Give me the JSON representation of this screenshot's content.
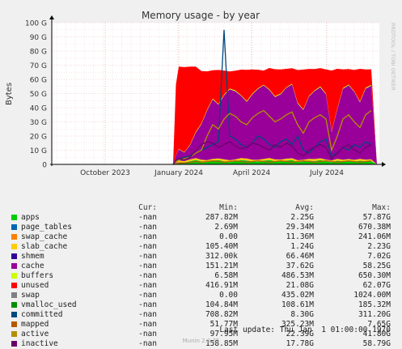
{
  "watermark": "RRDTOOL / TOBI OETIKER",
  "chart_data": {
    "type": "area",
    "title": "Memory usage - by year",
    "ylabel": "Bytes",
    "ylim": [
      0,
      100
    ],
    "y_ticks": [
      "0",
      "10 G",
      "20 G",
      "30 G",
      "40 G",
      "50 G",
      "60 G",
      "70 G",
      "80 G",
      "90 G",
      "100 G"
    ],
    "x_ticks": [
      "October 2023",
      "January 2024",
      "April 2024",
      "July 2024"
    ],
    "grid": true,
    "x": [
      0,
      0.5,
      1,
      2,
      3,
      4,
      5,
      6,
      7,
      8,
      9,
      10,
      11,
      12,
      13,
      14,
      15,
      16,
      17,
      18,
      19,
      20,
      21,
      22,
      23,
      24,
      25,
      26,
      27,
      28,
      29,
      30,
      31,
      32,
      33,
      34,
      35,
      36
    ],
    "x_unit": "weeks since first data (January 2024)",
    "series": [
      {
        "name": "apps",
        "color": "#00cc00",
        "values": [
          0,
          0.5,
          1.5,
          1.2,
          2.2,
          3,
          2,
          1.5,
          2.5,
          3,
          2,
          1.5,
          2.2,
          3,
          2.5,
          2,
          1.8,
          2.5,
          3,
          2.2,
          2,
          2.5,
          3,
          1.5,
          2,
          2.5,
          2.2,
          3,
          2,
          1.5,
          2.5,
          2,
          2.2,
          1.8,
          2.5,
          2,
          2.2
        ]
      },
      {
        "name": "page_tables",
        "color": "#0066b3",
        "values": [
          0,
          0.1,
          0.1,
          0.1,
          0.1,
          0.1,
          0.1,
          0.2,
          0.1,
          0.1,
          0.2,
          0.1,
          0.1,
          0.1,
          0.2,
          0.1,
          0.1,
          0.1,
          0.1,
          0.1,
          0.1,
          0.1,
          0.1,
          0.1,
          0.1,
          0.1,
          0.1,
          0.1,
          0.1,
          0.1,
          0.1,
          0.1,
          0.1,
          0.1,
          0.1,
          0.1,
          0.1
        ]
      },
      {
        "name": "swap_cache",
        "color": "#ff8000",
        "values": [
          0,
          0,
          0,
          0,
          0,
          0,
          0,
          0,
          0,
          0,
          0,
          0,
          0,
          0,
          0,
          0,
          0,
          0,
          0,
          0,
          0,
          0,
          0,
          0,
          0,
          0,
          0,
          0,
          0,
          0,
          0,
          0,
          0,
          0,
          0,
          0,
          0
        ]
      },
      {
        "name": "slab_cache",
        "color": "#ffcc00",
        "values": [
          0,
          0.5,
          1,
          1,
          1.2,
          1.3,
          1.2,
          1.3,
          1.2,
          1.1,
          1.4,
          1.3,
          1.2,
          1.3,
          1.4,
          1.2,
          1.3,
          1.2,
          1.3,
          1.2,
          1.3,
          1.4,
          1.2,
          1.3,
          1.2,
          1.3,
          1.4,
          1.2,
          1.3,
          1.2,
          1.3,
          1.2,
          1.4,
          1.3,
          1.2,
          1.3,
          1.2
        ]
      },
      {
        "name": "shmem",
        "color": "#330099",
        "values": [
          0,
          0,
          0.1,
          0.05,
          0.1,
          0.05,
          0.1,
          0.05,
          0.1,
          0.05,
          0.1,
          0.05,
          0.1,
          0.05,
          0.1,
          0.05,
          0.1,
          0.05,
          0.1,
          0.05,
          0.1,
          0.05,
          0.1,
          0.05,
          0.1,
          0.05,
          0.1,
          0.05,
          0.1,
          0.05,
          0.1,
          0.05,
          0.1,
          0.05,
          0.1,
          0.05,
          0.1
        ]
      },
      {
        "name": "cache",
        "color": "#990099",
        "values": [
          0,
          5,
          8,
          6,
          10,
          18,
          25,
          35,
          42,
          38,
          45,
          50,
          48,
          44,
          40,
          46,
          50,
          52,
          48,
          44,
          46,
          50,
          52,
          40,
          35,
          44,
          48,
          50,
          46,
          20,
          35,
          50,
          52,
          48,
          40,
          50,
          52
        ]
      },
      {
        "name": "buffers",
        "color": "#ccff00",
        "values": [
          0,
          0.2,
          0.3,
          0.3,
          0.4,
          0.5,
          0.5,
          0.6,
          0.5,
          0.4,
          0.5,
          0.6,
          0.5,
          0.4,
          0.5,
          0.6,
          0.5,
          0.4,
          0.5,
          0.6,
          0.5,
          0.4,
          0.5,
          0.6,
          0.5,
          0.4,
          0.5,
          0.6,
          0.5,
          0.4,
          0.5,
          0.6,
          0.5,
          0.4,
          0.5,
          0.6,
          0.5
        ]
      },
      {
        "name": "unused",
        "color": "#ff0000",
        "values": [
          0,
          50,
          58,
          60,
          55,
          46,
          37,
          27,
          20,
          24,
          17,
          12,
          14,
          18,
          22,
          17,
          13,
          10,
          15,
          19,
          17,
          13,
          11,
          23,
          28,
          19,
          15,
          13,
          17,
          43,
          28,
          13,
          11,
          15,
          23,
          13,
          11
        ]
      },
      {
        "name": "swap",
        "color": "#808080",
        "values": [
          0,
          0,
          0,
          0,
          0,
          0,
          0,
          0,
          0,
          0,
          0,
          0,
          0,
          0,
          0,
          0,
          0,
          0,
          0,
          0,
          0,
          0,
          0,
          0,
          0,
          0,
          0,
          0,
          0,
          0,
          0,
          0,
          0,
          0,
          0,
          0,
          0
        ]
      }
    ],
    "line_series": [
      {
        "name": "vmalloc_used",
        "color": "#008f00",
        "values": [
          0,
          0.1,
          0.1,
          0.1,
          0.1,
          0.1,
          0.1,
          0.1,
          0.1,
          0.1,
          0.1,
          0.1,
          0.1,
          0.1,
          0.1,
          0.1,
          0.1,
          0.1,
          0.1,
          0.1,
          0.1,
          0.1,
          0.1,
          0.1,
          0.1,
          0.1,
          0.1,
          0.1,
          0.1,
          0.1,
          0.1,
          0.1,
          0.1,
          0.1,
          0.1,
          0.1,
          0.1
        ]
      },
      {
        "name": "committed",
        "color": "#00487d",
        "values": [
          0,
          2,
          4,
          5,
          6,
          8,
          10,
          12,
          14,
          16,
          95,
          20,
          18,
          14,
          12,
          15,
          20,
          18,
          14,
          12,
          16,
          18,
          14,
          20,
          10,
          8,
          12,
          16,
          18,
          6,
          8,
          12,
          10,
          14,
          12,
          16,
          14
        ]
      },
      {
        "name": "mapped",
        "color": "#b35a00",
        "values": [
          0,
          0.5,
          1,
          1,
          1.5,
          2,
          1.5,
          2,
          2.5,
          2,
          1.5,
          2,
          2.5,
          2,
          1.5,
          2,
          2.5,
          2,
          1.5,
          2,
          2.5,
          2,
          1.5,
          2,
          2.5,
          2,
          1.5,
          2,
          2.5,
          2,
          1.5,
          2,
          2.5,
          2,
          1.5,
          2,
          2.5
        ]
      },
      {
        "name": "active",
        "color": "#b38f00",
        "values": [
          0,
          2,
          3,
          4,
          5,
          8,
          10,
          20,
          28,
          25,
          32,
          36,
          34,
          30,
          28,
          33,
          36,
          38,
          34,
          30,
          32,
          35,
          37,
          28,
          22,
          30,
          33,
          35,
          32,
          10,
          20,
          32,
          35,
          30,
          26,
          35,
          38
        ]
      },
      {
        "name": "inactive",
        "color": "#6b006b",
        "values": [
          0,
          3,
          4,
          3,
          5,
          10,
          14,
          16,
          15,
          12,
          14,
          16,
          13,
          11,
          12,
          15,
          14,
          12,
          10,
          14,
          12,
          15,
          13,
          8,
          6,
          10,
          12,
          14,
          12,
          4,
          8,
          12,
          14,
          10,
          8,
          12,
          14
        ]
      }
    ]
  },
  "legend": {
    "headers": {
      "cur": "Cur:",
      "min": "Min:",
      "avg": "Avg:",
      "max": "Max:"
    },
    "rows": [
      {
        "name": "apps",
        "color": "#00cc00",
        "cur": "-nan",
        "min": "287.82M",
        "avg": "2.25G",
        "max": "57.87G"
      },
      {
        "name": "page_tables",
        "color": "#0066b3",
        "cur": "-nan",
        "min": "2.69M",
        "avg": "29.34M",
        "max": "670.38M"
      },
      {
        "name": "swap_cache",
        "color": "#ff8000",
        "cur": "-nan",
        "min": "0.00",
        "avg": "11.36M",
        "max": "241.06M"
      },
      {
        "name": "slab_cache",
        "color": "#ffcc00",
        "cur": "-nan",
        "min": "105.40M",
        "avg": "1.24G",
        "max": "2.23G"
      },
      {
        "name": "shmem",
        "color": "#330099",
        "cur": "-nan",
        "min": "312.00k",
        "avg": "66.46M",
        "max": "7.02G"
      },
      {
        "name": "cache",
        "color": "#990099",
        "cur": "-nan",
        "min": "151.21M",
        "avg": "37.62G",
        "max": "58.25G"
      },
      {
        "name": "buffers",
        "color": "#ccff00",
        "cur": "-nan",
        "min": "6.58M",
        "avg": "486.53M",
        "max": "650.30M"
      },
      {
        "name": "unused",
        "color": "#ff0000",
        "cur": "-nan",
        "min": "416.91M",
        "avg": "21.08G",
        "max": "62.07G"
      },
      {
        "name": "swap",
        "color": "#808080",
        "cur": "-nan",
        "min": "0.00",
        "avg": "435.02M",
        "max": "1024.00M"
      },
      {
        "name": "vmalloc_used",
        "color": "#008f00",
        "cur": "-nan",
        "min": "104.84M",
        "avg": "108.61M",
        "max": "185.32M"
      },
      {
        "name": "committed",
        "color": "#00487d",
        "cur": "-nan",
        "min": "708.82M",
        "avg": "8.30G",
        "max": "311.20G"
      },
      {
        "name": "mapped",
        "color": "#b35a00",
        "cur": "-nan",
        "min": "51.77M",
        "avg": "325.23M",
        "max": "7.65G"
      },
      {
        "name": "active",
        "color": "#b38f00",
        "cur": "-nan",
        "min": "97.95M",
        "avg": "22.39G",
        "max": "41.80G"
      },
      {
        "name": "inactive",
        "color": "#6b006b",
        "cur": "-nan",
        "min": "158.85M",
        "avg": "17.78G",
        "max": "58.79G"
      }
    ]
  },
  "footer": {
    "last_update": "Last update: Thu Jan  1 01:00:00 1970",
    "version": "Munin 2.0.75"
  }
}
